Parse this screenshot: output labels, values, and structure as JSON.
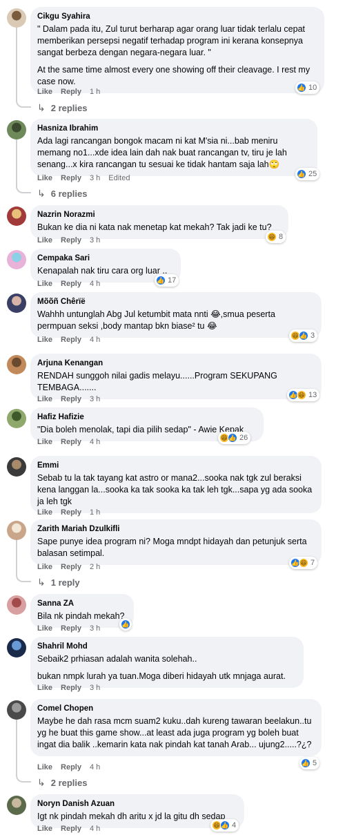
{
  "comments": [
    {
      "name": "Cikgu Syahira",
      "texts": [
        "\" Dalam pada itu, Zul turut berharap agar orang luar tidak terlalu cepat memberikan persepsi negatif terhadap program ini kerana konsepnya sangat berbeza dengan negara-negara luar. \"",
        "At the same time almost every one showing off their cleavage. I rest my case now."
      ],
      "like": "Like",
      "reply": "Reply",
      "time": "1 h",
      "edited": "",
      "react_count": "10",
      "reacts": [
        "like"
      ],
      "replies": "2 replies"
    },
    {
      "name": "Hasniza Ibrahim",
      "texts": [
        "Ada lagi rancangan bongok macam ni kat M'sia ni...bab meniru memang no1...xde idea lain dah nak buat rancangan tv, tiru je lah senang...x kira rancangan tu sesuai ke tidak hantam saja lah🙄"
      ],
      "like": "Like",
      "reply": "Reply",
      "time": "3 h",
      "edited": "Edited",
      "react_count": "25",
      "reacts": [
        "like"
      ],
      "replies": "6 replies"
    },
    {
      "name": "Nazrin Norazmi",
      "texts": [
        "Bukan ke dia ni kata nak menetap kat mekah? Tak jadi ke tu?"
      ],
      "like": "Like",
      "reply": "Reply",
      "time": "3 h",
      "edited": "",
      "react_count": "8",
      "reacts": [
        "haha"
      ],
      "replies": ""
    },
    {
      "name": "Cempaka Sari",
      "texts": [
        "Kenapalah nak tiru cara org luar .."
      ],
      "like": "Like",
      "reply": "Reply",
      "time": "4 h",
      "edited": "",
      "react_count": "17",
      "reacts": [
        "like"
      ],
      "replies": ""
    },
    {
      "name": "Mõõñ Chêrïë",
      "texts": [
        "Wahhh untunglah Abg Jul ketumbit mata nnti 😂,smua peserta permpuan seksi ,body mantap bkn biase² tu 😂"
      ],
      "like": "Like",
      "reply": "Reply",
      "time": "4 h",
      "edited": "",
      "react_count": "3",
      "reacts": [
        "haha",
        "like"
      ],
      "replies": ""
    },
    {
      "name": "Arjuna Kenangan",
      "texts": [
        "RENDAH sunggoh nilai gadis melayu......Program SEKUPANG TEMBAGA......."
      ],
      "like": "Like",
      "reply": "Reply",
      "time": "3 h",
      "edited": "",
      "react_count": "13",
      "reacts": [
        "like",
        "haha"
      ],
      "replies": ""
    },
    {
      "name": "Hafiz Hafizie",
      "texts": [
        "\"Dia boleh menolak, tapi dia pilih sedap\" - Awie Kepak"
      ],
      "like": "Like",
      "reply": "Reply",
      "time": "4 h",
      "edited": "",
      "react_count": "26",
      "reacts": [
        "haha",
        "like"
      ],
      "replies": ""
    },
    {
      "name": "Emmi",
      "texts": [
        "Sebab tu la tak tayang kat astro or mana2...sooka nak tgk zul beraksi kena langgan la...sooka ka tak sooka ka tak leh tgk...sapa yg ada sooka ja leh tgk"
      ],
      "like": "Like",
      "reply": "Reply",
      "time": "1 h",
      "edited": "",
      "react_count": "",
      "reacts": [],
      "replies": ""
    },
    {
      "name": "Zarith Mariah Dzulkifli",
      "texts": [
        "Sape punye idea program ni? Moga mndpt hidayah dan petunjuk serta balasan setimpal."
      ],
      "like": "Like",
      "reply": "Reply",
      "time": "2 h",
      "edited": "",
      "react_count": "7",
      "reacts": [
        "like",
        "haha"
      ],
      "replies": "1 reply"
    },
    {
      "name": "Sanna ZA",
      "texts": [
        "Bila nk pindah mekah?"
      ],
      "like": "Like",
      "reply": "Reply",
      "time": "3 h",
      "edited": "",
      "react_count": "",
      "reacts": [
        "like"
      ],
      "replies": ""
    },
    {
      "name": "Shahril Mohd",
      "texts": [
        "Sebaik2 prhiasan adalah wanita solehah..",
        "bukan nmpk lurah ya tuan.Moga diberi hidayah utk mnjaga aurat."
      ],
      "like": "Like",
      "reply": "Reply",
      "time": "3 h",
      "edited": "",
      "react_count": "",
      "reacts": [],
      "replies": ""
    },
    {
      "name": "Comel Chopen",
      "texts": [
        "Maybe he dah rasa mcm suam2 kuku..dah kureng tawaran beelakun..tu yg he buat this game show...at least ada juga program yg boleh buat ingat dia balik ..kemarin kata nak pindah kat tanah Arab... ujung2.....?¿?"
      ],
      "like": "Like",
      "reply": "Reply",
      "time": "4 h",
      "edited": "",
      "react_count": "5",
      "reacts": [
        "like"
      ],
      "replies": "2 replies"
    },
    {
      "name": "Noryn Danish Azuan",
      "texts": [
        "Igt nk pindah mekah dh aritu x jd la gitu dh sedap"
      ],
      "like": "Like",
      "reply": "Reply",
      "time": "4 h",
      "edited": "",
      "react_count": "4",
      "reacts": [
        "haha",
        "like"
      ],
      "replies": ""
    }
  ],
  "colors": {
    "bubble": "#f0f2f5",
    "meta": "#65676b",
    "like_blue": "#1877f2",
    "haha_yellow": "#f7b928"
  }
}
